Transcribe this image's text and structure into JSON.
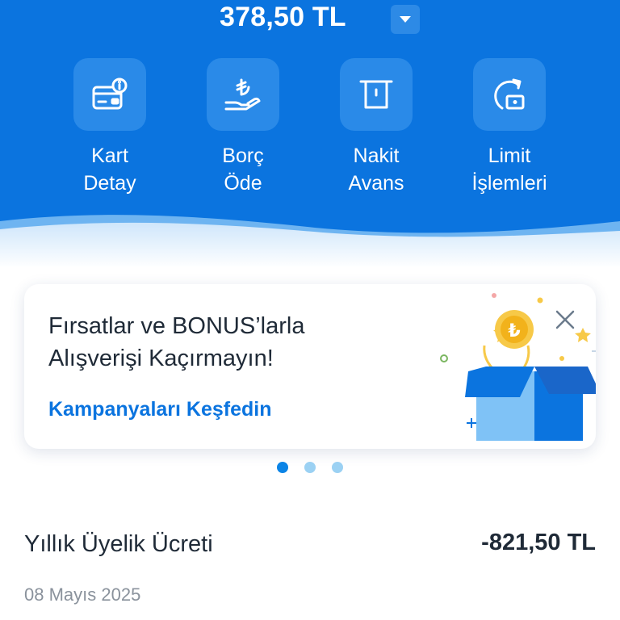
{
  "header": {
    "balance": "378,50 TL",
    "balance_toggle_icon": "caret-down-icon",
    "background_color": "#0b74df"
  },
  "actions": [
    {
      "label": "Kart\nDetay",
      "icon": "card-info-icon"
    },
    {
      "label": "Borç\nÖde",
      "icon": "lira-hand-icon"
    },
    {
      "label": "Nakit\nAvans",
      "icon": "atm-cash-icon"
    },
    {
      "label": "Limit\nİşlemleri",
      "icon": "limit-refresh-icon"
    }
  ],
  "promo": {
    "title": "Fırsatlar ve BONUS’larla\nAlışverişi Kaçırmayın!",
    "link": "Kampanyaları Keşfedin",
    "close_icon": "close-icon",
    "illustration": "gift-box-coin-illustration"
  },
  "carousel": {
    "pages": 3,
    "active_index": 0
  },
  "transaction": {
    "title": "Yıllık Üyelik Ücreti",
    "amount": "-821,50 TL",
    "date": "08 Mayıs 2025"
  },
  "colors": {
    "primary": "#0b74df",
    "link": "#0b74df",
    "text": "#1f2a37",
    "muted": "#8a929c",
    "dot_inactive": "#9bd1f3"
  }
}
